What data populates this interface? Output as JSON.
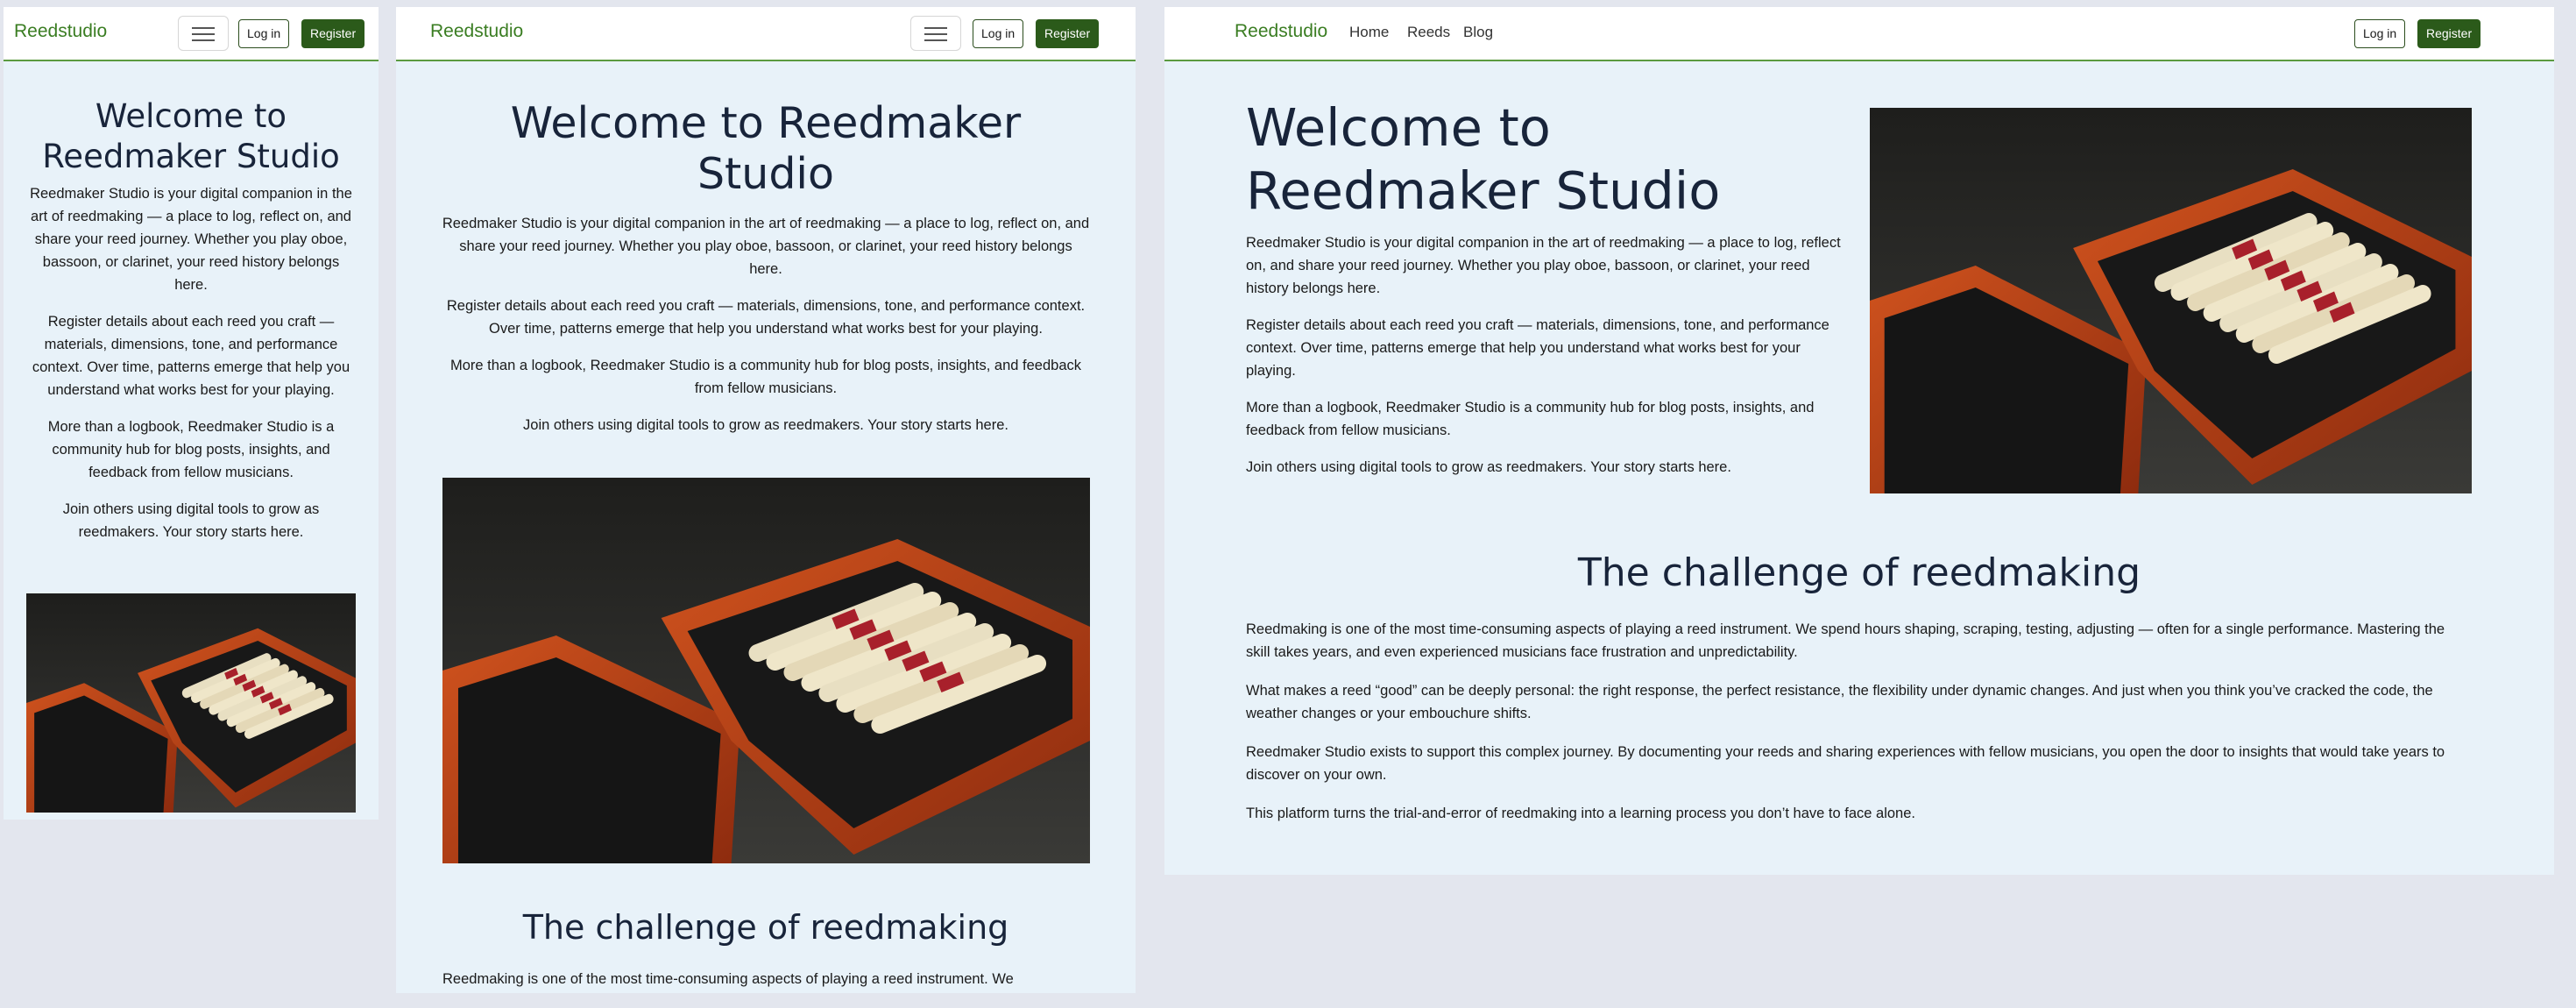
{
  "brand": "Reedstudio",
  "nav": {
    "toggle_label": "Toggle navigation",
    "links": [
      "Home",
      "Reeds",
      "Blog"
    ],
    "login_label": "Log in",
    "register_label": "Register"
  },
  "hero": {
    "title": "Welcome to Reedmaker Studio",
    "title_line1": "Welcome to",
    "title_line2": "Reedmaker Studio",
    "paragraphs": [
      "Reedmaker Studio is your digital companion in the art of reedmaking — a place to log, reflect on, and share your reed journey. Whether you play oboe, bassoon, or clarinet, your reed history belongs here.",
      "Register details about each reed you craft — materials, dimensions, tone, and performance context. Over time, patterns emerge that help you understand what works best for your playing.",
      "More than a logbook, Reedmaker Studio is a community hub for blog posts, insights, and feedback from fellow musicians.",
      "Join others using digital tools to grow as reedmakers. Your story starts here."
    ],
    "image_alt": "Reed case with oboe reeds"
  },
  "challenge": {
    "title": "The challenge of reedmaking",
    "paragraphs": [
      "Reedmaking is one of the most time-consuming aspects of playing a reed instrument. We spend hours shaping, scraping, testing, adjusting — often for a single performance. Mastering the skill takes years, and even experienced musicians face frustration and unpredictability.",
      "What makes a reed “good” can be deeply personal: the right response, the perfect resistance, the flexibility under dynamic changes. And just when you think you’ve cracked the code, the weather changes or your embouchure shifts.",
      "Reedmaker Studio exists to support this complex journey. By documenting your reeds and sharing experiences with fellow musicians, you open the door to insights that would take years to discover on your own.",
      "This platform turns the trial-and-error of reedmaking into a learning process you don’t have to face alone."
    ],
    "visible_fragment": "Reedmaking is one of the most time-consuming aspects of playing a reed instrument. We"
  },
  "colors": {
    "brand_green": "#3a7d22",
    "register_bg": "#2b5a1a",
    "page_bg": "#e8f2f9",
    "heading": "#18243a"
  }
}
